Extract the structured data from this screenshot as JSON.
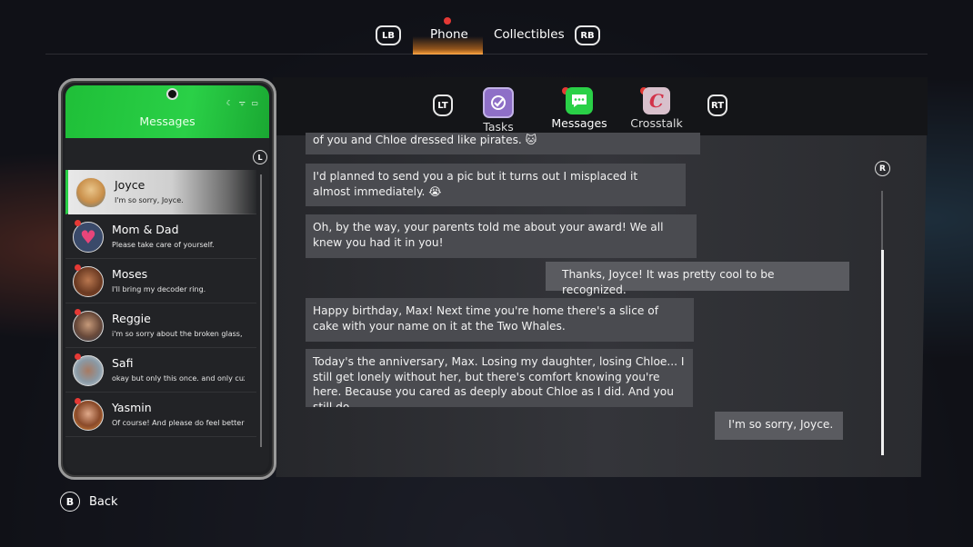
{
  "top_nav": {
    "left_button": "LB",
    "right_button": "RB",
    "tabs": [
      {
        "label": "Phone",
        "active": true,
        "notification": true
      },
      {
        "label": "Collectibles",
        "active": false,
        "notification": false
      }
    ]
  },
  "phone": {
    "title": "Messages",
    "scroll_badge": "L",
    "contacts": [
      {
        "name": "Joyce",
        "preview": "I'm so sorry, Joyce.",
        "active": true,
        "unread": false
      },
      {
        "name": "Mom & Dad",
        "preview": "Please take care of yourself.",
        "active": false,
        "unread": true
      },
      {
        "name": "Moses",
        "preview": "I'll bring my decoder ring.",
        "active": false,
        "unread": true
      },
      {
        "name": "Reggie",
        "preview": "i'm so sorry about the broken glass,",
        "active": false,
        "unread": true
      },
      {
        "name": "Safi",
        "preview": "okay but only this once. and only cuz",
        "active": false,
        "unread": true
      },
      {
        "name": "Yasmin",
        "preview": "Of course! And please do feel better",
        "active": false,
        "unread": true
      }
    ]
  },
  "app_tabs": {
    "left_button": "LT",
    "right_button": "RT",
    "tabs": [
      {
        "label": "Tasks",
        "icon": "checkmark-icon",
        "color": "#8e6fc7",
        "notification": false
      },
      {
        "label": "Messages",
        "icon": "chat-bubble-icon",
        "color": "#2ad047",
        "notification": true
      },
      {
        "label": "Crosstalk",
        "icon": "crosstalk-c-icon",
        "color": "#c9a7b8",
        "notification": true
      }
    ]
  },
  "chat": {
    "scroll_badge": "R",
    "messages": [
      {
        "from": "in",
        "text": "of you and Chloe dressed like pirates. 🐱"
      },
      {
        "from": "in",
        "text": "I'd planned to send you a pic but it turns out I misplaced it almost immediately. 😭"
      },
      {
        "from": "in",
        "text": "Oh, by the way, your parents told me about your award! We all knew you had it in you!"
      },
      {
        "from": "out",
        "text": "Thanks, Joyce! It was pretty cool to be recognized."
      },
      {
        "from": "in",
        "text": "Happy birthday, Max! Next time you're home there's a slice of cake with your name on it at the Two Whales."
      },
      {
        "from": "in",
        "text": "Today's the anniversary, Max. Losing my daughter, losing Chloe... I still get lonely without her, but there's comfort knowing you're here. Because you cared as deeply about Chloe as I did. And you still do."
      },
      {
        "from": "out",
        "text": "I'm so sorry, Joyce."
      }
    ]
  },
  "footer": {
    "button": "B",
    "label": "Back"
  }
}
